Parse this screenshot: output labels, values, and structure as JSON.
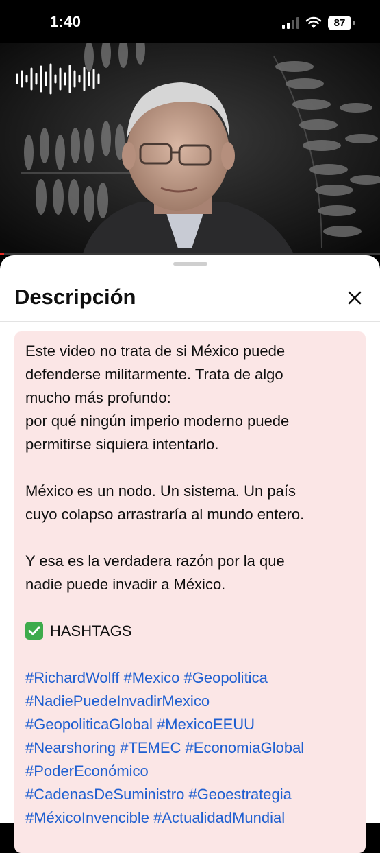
{
  "status": {
    "time": "1:40",
    "battery": "87"
  },
  "description": {
    "title": "Descripción",
    "paragraphs": [
      [
        "Este video no trata de si México puede",
        "defenderse militarmente. Trata de algo",
        "mucho más profundo:",
        "por qué ningún imperio moderno puede",
        "permitirse siquiera intentarlo."
      ],
      [
        "México es un nodo. Un sistema. Un país",
        "cuyo colapso arrastraría al mundo entero."
      ],
      [
        "Y esa es la verdadera razón por la que",
        "nadie puede invadir a México."
      ]
    ],
    "hashtags_heading": "HASHTAGS",
    "hashtag_lines": [
      "#RichardWolff #Mexico #Geopolitica",
      "#NadiePuedeInvadirMexico",
      "#GeopoliticaGlobal #MexicoEEUU",
      "#Nearshoring #TEMEC #EconomiaGlobal",
      "#PoderEconómico",
      "#CadenasDeSuministro #Geoestrategia",
      "#MéxicoInvencible #ActualidadMundial"
    ]
  },
  "icons": {
    "close": "close-icon",
    "audio": "audio-waveform-icon",
    "check": "check-mark-icon"
  },
  "colors": {
    "hashtag": "#1f5fd0",
    "description_bg": "#fbe6e6",
    "progress": "#e52d27"
  },
  "video": {
    "progress": 0.01
  }
}
